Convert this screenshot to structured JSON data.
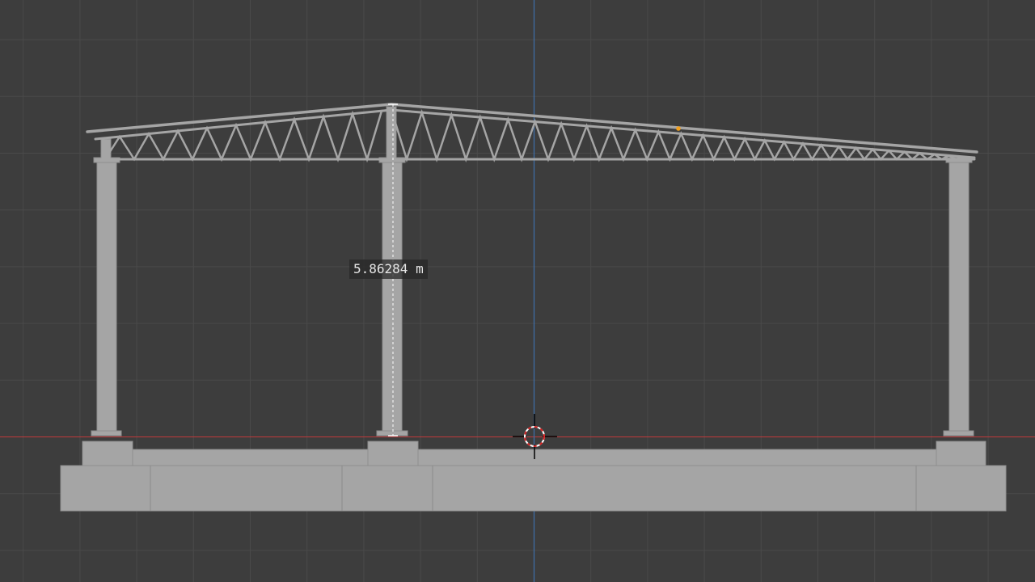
{
  "viewport": {
    "background": "#3d3d3d",
    "grid_color": "#4a4a4a",
    "x_axis_color": "#c0393b",
    "z_axis_color": "#3f6fa8",
    "model_color": "#a5a5a5",
    "highlight_vertex_color": "#f0a020"
  },
  "measure": {
    "value_text": "5.86284 m"
  },
  "cursor": {
    "icon": "3d-cursor-icon"
  }
}
